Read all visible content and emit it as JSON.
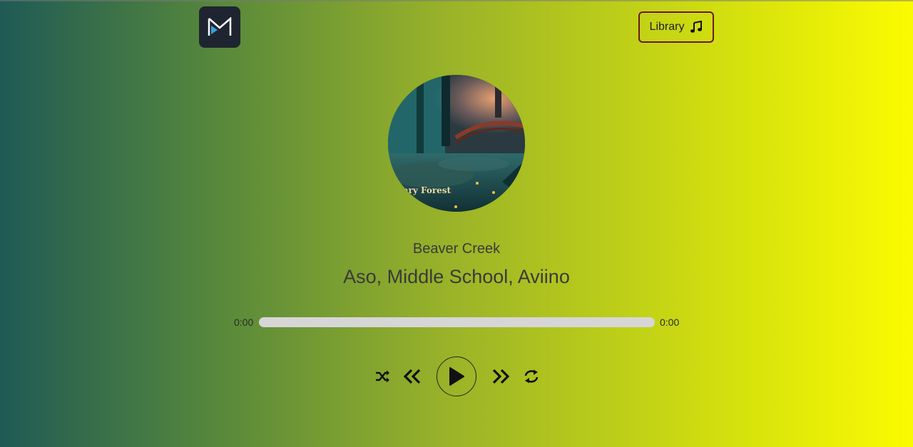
{
  "header": {
    "logo_icon": "m-logo-icon",
    "library_label": "Library",
    "library_icon": "music-note-icon"
  },
  "now_playing": {
    "cover_icon": "album-cover",
    "cover_text": "nary Forest",
    "song_title": "Beaver Creek",
    "artist": "Aso, Middle School, Aviino"
  },
  "player": {
    "current_time": "0:00",
    "duration": "0:00",
    "progress": 0
  },
  "controls": {
    "shuffle_icon": "shuffle-icon",
    "previous_icon": "previous-icon",
    "play_icon": "play-icon",
    "next_icon": "next-icon",
    "repeat_icon": "repeat-icon"
  },
  "colors": {
    "gradient_start": "#1f5a55",
    "gradient_end": "#fbfb00",
    "library_border": "#6a1a1a",
    "track": "#d6d6d6"
  }
}
